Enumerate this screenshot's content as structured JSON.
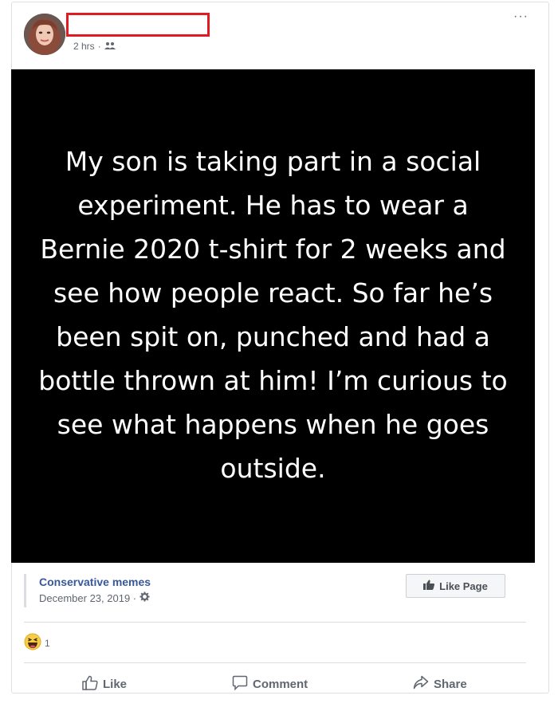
{
  "post": {
    "timestamp": "2 hrs",
    "audience_icon": "friends-icon",
    "more_icon": "more-options-icon",
    "more_label": "···",
    "meme_text": "My son is taking part in a social experiment. He has to wear a Bernie 2020 t-shirt for 2 weeks and see how people react. So far he’s been spit on, punched and had a bottle thrown at him! I’m curious to see what happens when he goes outside."
  },
  "source": {
    "page_name": "Conservative memes",
    "date": "December 23, 2019 ·",
    "privacy_icon": "gear-icon",
    "like_page_label": "Like Page"
  },
  "reactions": {
    "icon": "haha-reaction-icon",
    "count": "1"
  },
  "actions": {
    "like": "Like",
    "comment": "Comment",
    "share": "Share"
  },
  "colors": {
    "link": "#385898",
    "redaction_box": "#e01b22",
    "meme_background": "#000000"
  }
}
